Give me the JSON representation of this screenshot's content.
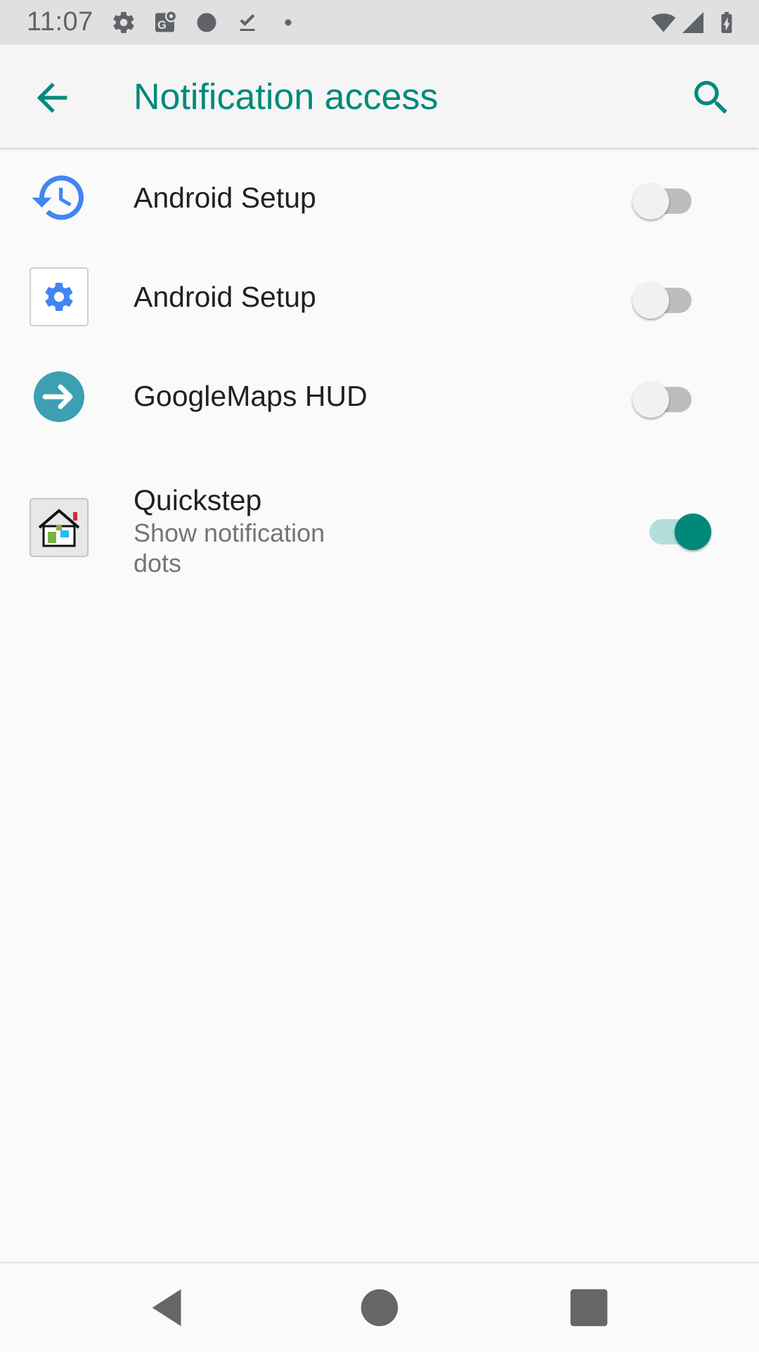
{
  "status_bar": {
    "time": "11:07",
    "left_icons": [
      "gear-icon",
      "maps-icon",
      "circle-icon",
      "download-done-icon",
      "dot-icon"
    ],
    "right_icons": [
      "wifi-icon",
      "cell-signal-icon",
      "battery-charging-icon"
    ]
  },
  "app_bar": {
    "title": "Notification access",
    "accent_color": "#00897b"
  },
  "apps": [
    {
      "name": "Android Setup",
      "summary": "",
      "icon": "restore-clock-icon",
      "enabled": false
    },
    {
      "name": "Android Setup",
      "summary": "",
      "icon": "settings-gear-icon",
      "enabled": false
    },
    {
      "name": "GoogleMaps HUD",
      "summary": "",
      "icon": "arrow-circle-icon",
      "enabled": false
    },
    {
      "name": "Quickstep",
      "summary": "Show notification dots",
      "icon": "house-icon",
      "enabled": true
    }
  ],
  "nav_bar": {
    "buttons": [
      "back-icon",
      "home-icon",
      "recents-icon"
    ]
  }
}
